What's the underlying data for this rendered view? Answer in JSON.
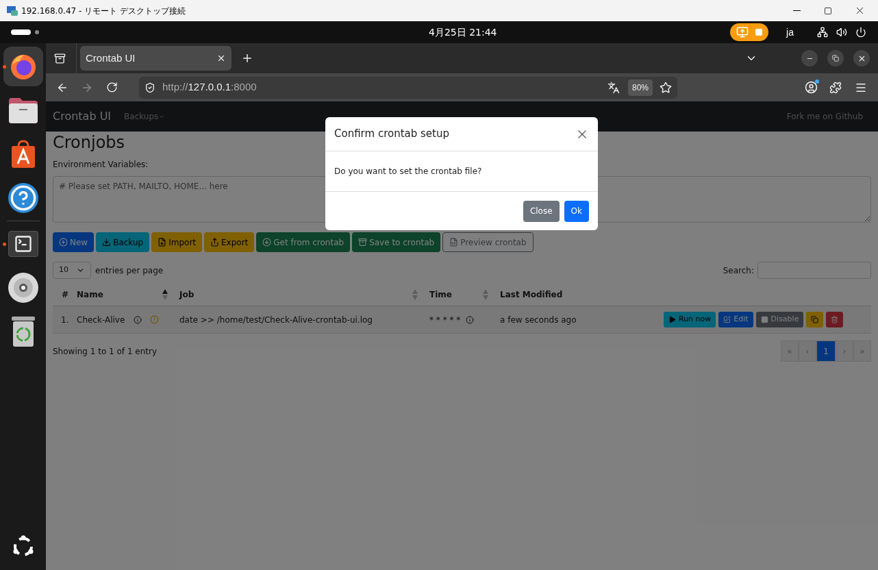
{
  "rdp_window": {
    "title": "192.168.0.47 - リモート デスクトップ接続"
  },
  "top_bar": {
    "clock": "4月25日  21:44",
    "language": "ja",
    "screen_share": true
  },
  "dock": {
    "items": [
      {
        "kind": "browser",
        "selected": true,
        "running": true
      },
      {
        "kind": "files",
        "selected": false,
        "running": false
      },
      {
        "kind": "store",
        "selected": false,
        "running": false
      },
      {
        "kind": "help",
        "selected": false,
        "running": false
      },
      {
        "kind": "terminal",
        "selected": false,
        "running": true
      },
      {
        "kind": "disc",
        "selected": false,
        "running": false
      },
      {
        "kind": "trash",
        "selected": false,
        "running": false
      }
    ]
  },
  "browser": {
    "tabs": [
      {
        "title": "Crontab UI",
        "selected": true
      }
    ],
    "url": {
      "scheme": "http://",
      "host": "127.0.0.1",
      "port": ":8000"
    },
    "zoom": "80%",
    "account_badge": true
  },
  "page": {
    "navbar": {
      "brand": "Crontab UI",
      "menu": "Backups",
      "link": "Fork me on Github"
    },
    "heading": "Cronjobs",
    "env_label": "Environment Variables:",
    "env_placeholder": "# Please set PATH, MAILTO, HOME... here",
    "toolbar": [
      {
        "kind": "new",
        "label": "New"
      },
      {
        "kind": "backup",
        "label": "Backup"
      },
      {
        "kind": "import",
        "label": "Import"
      },
      {
        "kind": "export",
        "label": "Export"
      },
      {
        "kind": "get",
        "label": "Get from crontab"
      },
      {
        "kind": "save",
        "label": "Save to crontab"
      },
      {
        "kind": "preview",
        "label": "Preview crontab"
      }
    ],
    "length_value": "10",
    "length_label": "entries per page",
    "search_label": "Search:",
    "table": {
      "columns": [
        {
          "label": "#",
          "sortable": false
        },
        {
          "label": "Name",
          "sortable": true,
          "sorted": true
        },
        {
          "label": "Job",
          "sortable": true,
          "sorted": false
        },
        {
          "label": "Time",
          "sortable": true,
          "sorted": false
        },
        {
          "label": "Last Modified",
          "sortable": false
        }
      ],
      "rows": [
        {
          "index": "1.",
          "name": "Check-Alive",
          "warning": true,
          "job": "date >> /home/test/Check-Alive-crontab-ui.log",
          "time": "* * * * *",
          "last_modified": "a few seconds ago",
          "actions": [
            {
              "kind": "run",
              "label": "Run now"
            },
            {
              "kind": "edit",
              "label": "Edit"
            },
            {
              "kind": "disable",
              "label": "Disable"
            },
            {
              "kind": "duplicate"
            },
            {
              "kind": "delete"
            }
          ]
        }
      ]
    },
    "info": "Showing 1 to 1 of 1 entry",
    "pagination": [
      {
        "label": "«",
        "selected": false,
        "disabled": true
      },
      {
        "label": "‹",
        "selected": false,
        "disabled": true
      },
      {
        "label": "1",
        "selected": true,
        "disabled": false
      },
      {
        "label": "›",
        "selected": false,
        "disabled": true
      },
      {
        "label": "»",
        "selected": false,
        "disabled": true
      }
    ]
  },
  "dialog": {
    "title": "Confirm crontab setup",
    "message": "Do you want to set the crontab file?",
    "buttons": [
      {
        "kind": "secondary",
        "label": "Close"
      },
      {
        "kind": "primary",
        "label": "Ok"
      }
    ]
  }
}
